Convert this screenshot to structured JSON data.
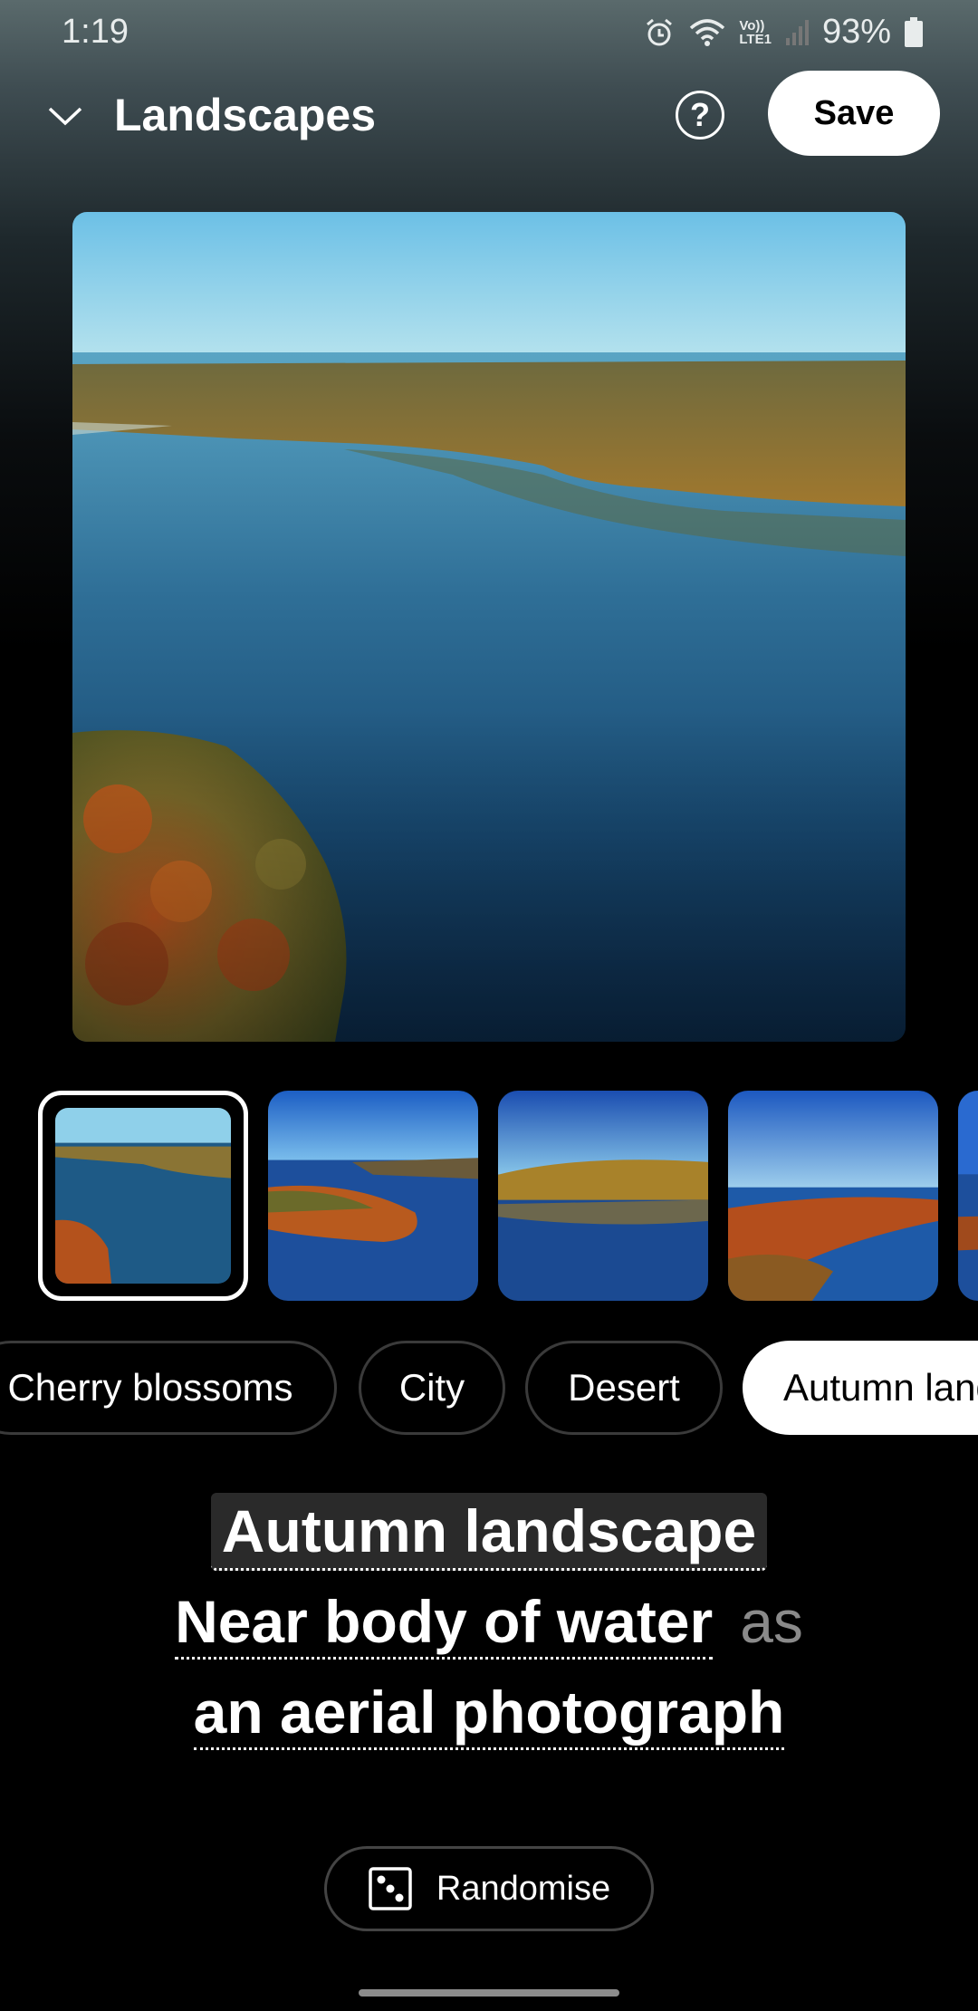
{
  "status_bar": {
    "time": "1:19",
    "network_label": "LTE1",
    "volte_label": "Vo))",
    "battery": "93%"
  },
  "header": {
    "title": "Landscapes",
    "help_label": "?",
    "save_label": "Save"
  },
  "thumbnails": [
    {
      "selected": true
    },
    {
      "selected": false
    },
    {
      "selected": false
    },
    {
      "selected": false
    }
  ],
  "chips": [
    {
      "label": "Cherry blossoms",
      "active": false
    },
    {
      "label": "City",
      "active": false
    },
    {
      "label": "Desert",
      "active": false
    },
    {
      "label": "Autumn landscape",
      "active": true
    }
  ],
  "prompt": {
    "line1": "Autumn landscape",
    "line2": "Near body of water",
    "connector": "as",
    "line3": "an aerial photograph"
  },
  "randomise_label": "Randomise",
  "colors": {
    "accent": "#ffffff",
    "background": "#000000"
  }
}
